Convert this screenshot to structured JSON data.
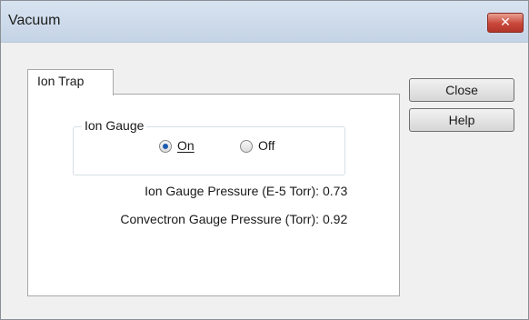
{
  "window": {
    "title": "Vacuum",
    "close_glyph": "✕"
  },
  "tabs": [
    {
      "label": "Ion Trap",
      "selected": true
    }
  ],
  "ion_gauge_group": {
    "legend": "Ion Gauge",
    "options": [
      {
        "label": "On",
        "selected": true
      },
      {
        "label": "Off",
        "selected": false
      }
    ]
  },
  "readings": [
    {
      "label": "Ion Gauge Pressure (E-5 Torr):",
      "value": "0.73"
    },
    {
      "label": "Convectron Gauge Pressure (Torr):",
      "value": "0.92"
    }
  ],
  "buttons": {
    "close_label": "Close",
    "help_label": "Help"
  },
  "colors": {
    "radio_selected": "#1d5bb0",
    "close_button": "#c8473a"
  },
  "icons": {
    "window_close": "close-icon",
    "radio_selected_on": "radio-selected-icon",
    "radio_unselected_off": "radio-unselected-icon"
  }
}
